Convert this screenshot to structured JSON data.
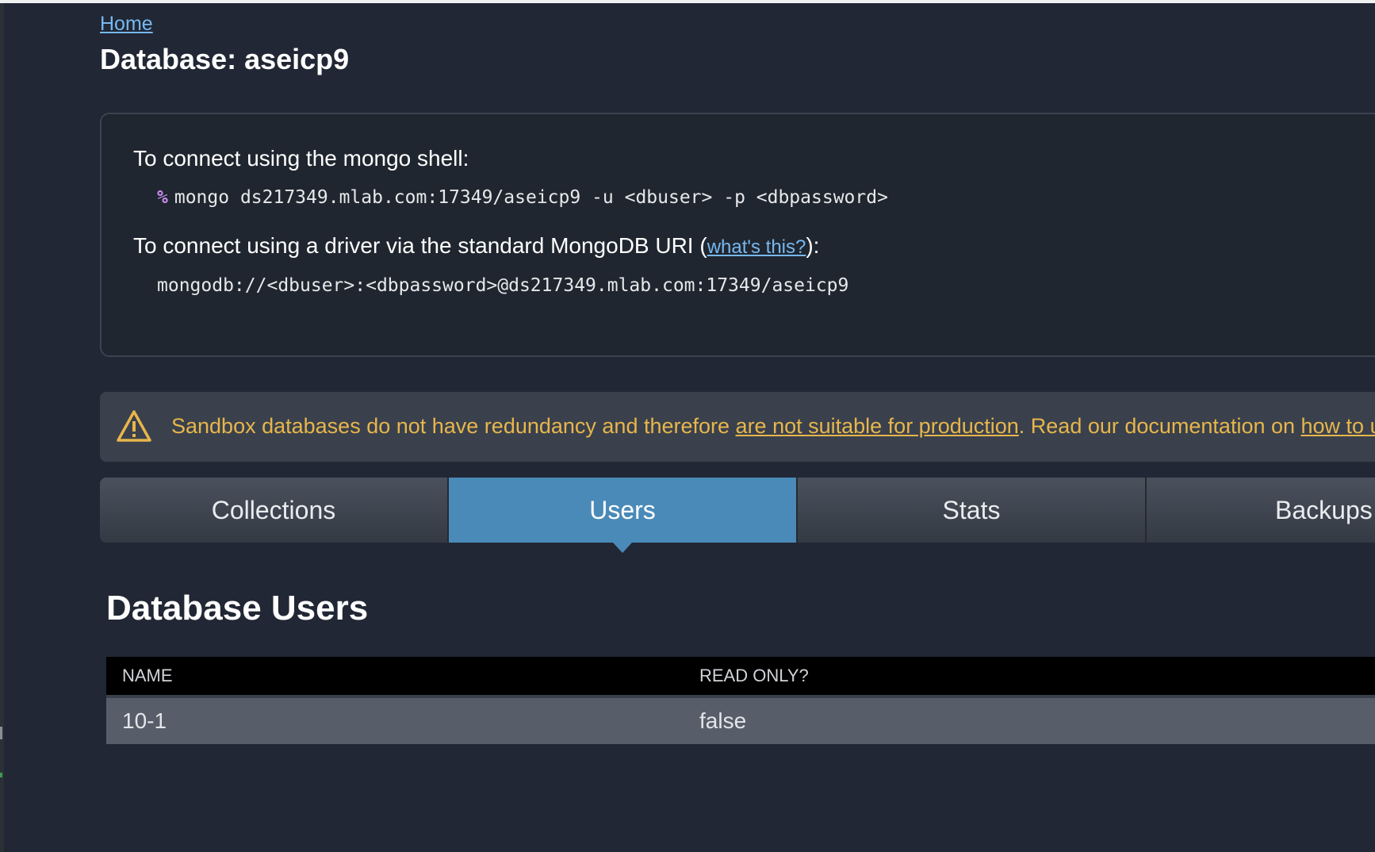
{
  "breadcrumb": {
    "home_label": "Home"
  },
  "page_title": "Database: aseicp9",
  "connect": {
    "shell_heading": "To connect using the mongo shell:",
    "shell_prompt": "%",
    "shell_command": "mongo ds217349.mlab.com:17349/aseicp9 -u <dbuser> -p <dbpassword>",
    "driver_heading_prefix": "To connect using a driver via the standard MongoDB URI (",
    "driver_link_label": "what's this?",
    "driver_heading_suffix": "):",
    "driver_uri": "mongodb://<dbuser>:<dbpassword>@ds217349.mlab.com:17349/aseicp9"
  },
  "warning": {
    "icon": "warning-triangle-icon",
    "text_before": "Sandbox databases do not have redundancy and therefore ",
    "link1": "are not suitable for production",
    "text_middle": ". Read our documentation on ",
    "link2": "how to upgrade",
    "color": "#e8b64a"
  },
  "tabs": [
    {
      "label": "Collections",
      "active": false
    },
    {
      "label": "Users",
      "active": true
    },
    {
      "label": "Stats",
      "active": false
    },
    {
      "label": "Backups",
      "active": false
    }
  ],
  "accent_color": "#4a8ab8",
  "section_title": "Database Users",
  "users_table": {
    "headers": [
      "NAME",
      "READ ONLY?"
    ],
    "rows": [
      {
        "name": "10-1",
        "read_only": "false"
      }
    ]
  }
}
